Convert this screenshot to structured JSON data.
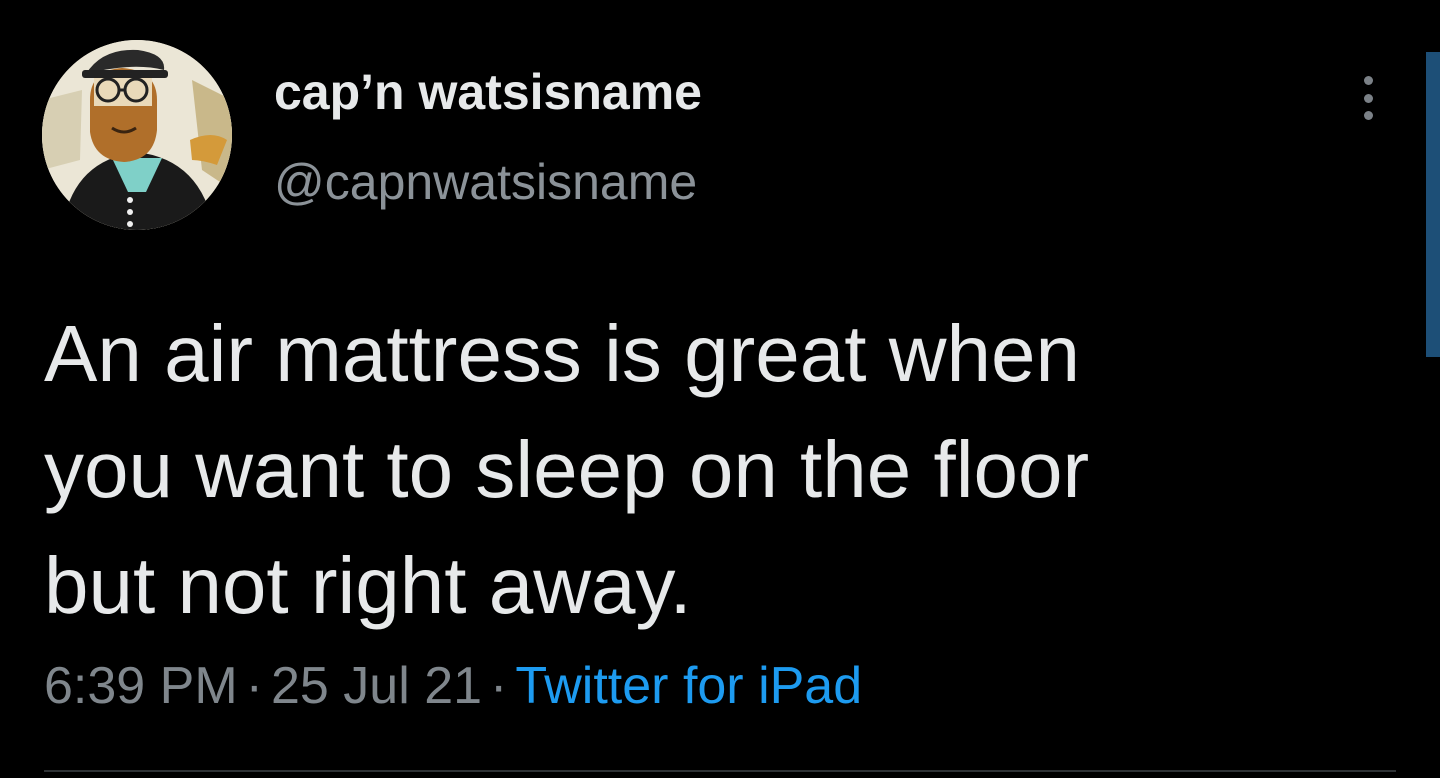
{
  "tweet": {
    "display_name": "cap’n watsisname",
    "handle": "@capnwatsisname",
    "text_lines": [
      "An air mattress is great when",
      "you want to sleep on the floor",
      "but not right away."
    ],
    "time": "6:39 PM",
    "separator": "·",
    "date": "25 Jul 21",
    "source": "Twitter for iPad",
    "avatar_icon": "cartoon-captain-avatar",
    "more_icon": "more-vertical-icon"
  },
  "colors": {
    "background": "#000000",
    "text": "#e7e9ea",
    "muted": "#7f868c",
    "link": "#1d9bf0",
    "scrollbar": "#1d4f77"
  }
}
